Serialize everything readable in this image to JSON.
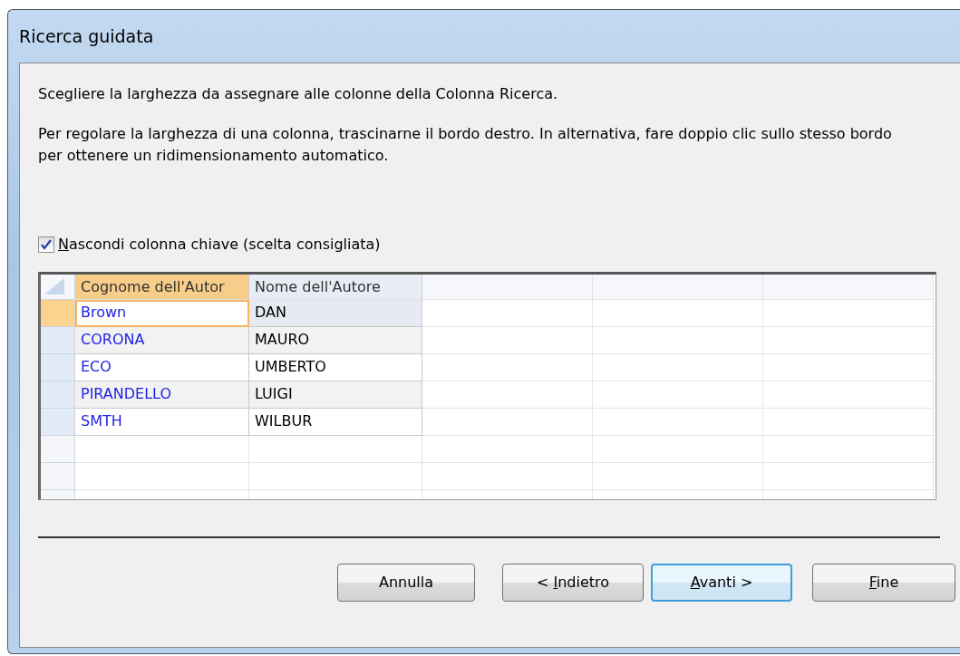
{
  "window": {
    "title": "Ricerca guidata"
  },
  "instructions": [
    "Scegliere la larghezza da assegnare alle colonne della Colonna Ricerca.",
    "Per regolare la larghezza di una colonna, trascinarne il bordo destro. In alternativa, fare doppio clic sullo stesso bordo per ottenere un ridimensionamento automatico."
  ],
  "hide_key_column": {
    "key": "N",
    "rest": "ascondi colonna chiave (scelta consigliata)",
    "checked": true
  },
  "grid": {
    "columns": [
      {
        "label": "Cognome dell'Autor",
        "selected": true
      },
      {
        "label": "Nome dell'Autore",
        "selected": false
      }
    ],
    "rows": [
      {
        "cells": [
          "Brown",
          "DAN"
        ],
        "selected": true
      },
      {
        "cells": [
          "CORONA",
          "MAURO"
        ],
        "selected": false
      },
      {
        "cells": [
          "ECO",
          "UMBERTO"
        ],
        "selected": false
      },
      {
        "cells": [
          "PIRANDELLO",
          "LUIGI"
        ],
        "selected": false
      },
      {
        "cells": [
          "SMTH",
          "WILBUR"
        ],
        "selected": false
      }
    ]
  },
  "buttons": [
    {
      "prefix": "Annulla",
      "default": false
    },
    {
      "prefix": "< ",
      "key": "I",
      "rest": "ndietro",
      "default": false
    },
    {
      "key": "A",
      "rest": "vanti >",
      "default": true
    },
    {
      "key": "F",
      "rest": "ine",
      "default": false
    }
  ]
}
